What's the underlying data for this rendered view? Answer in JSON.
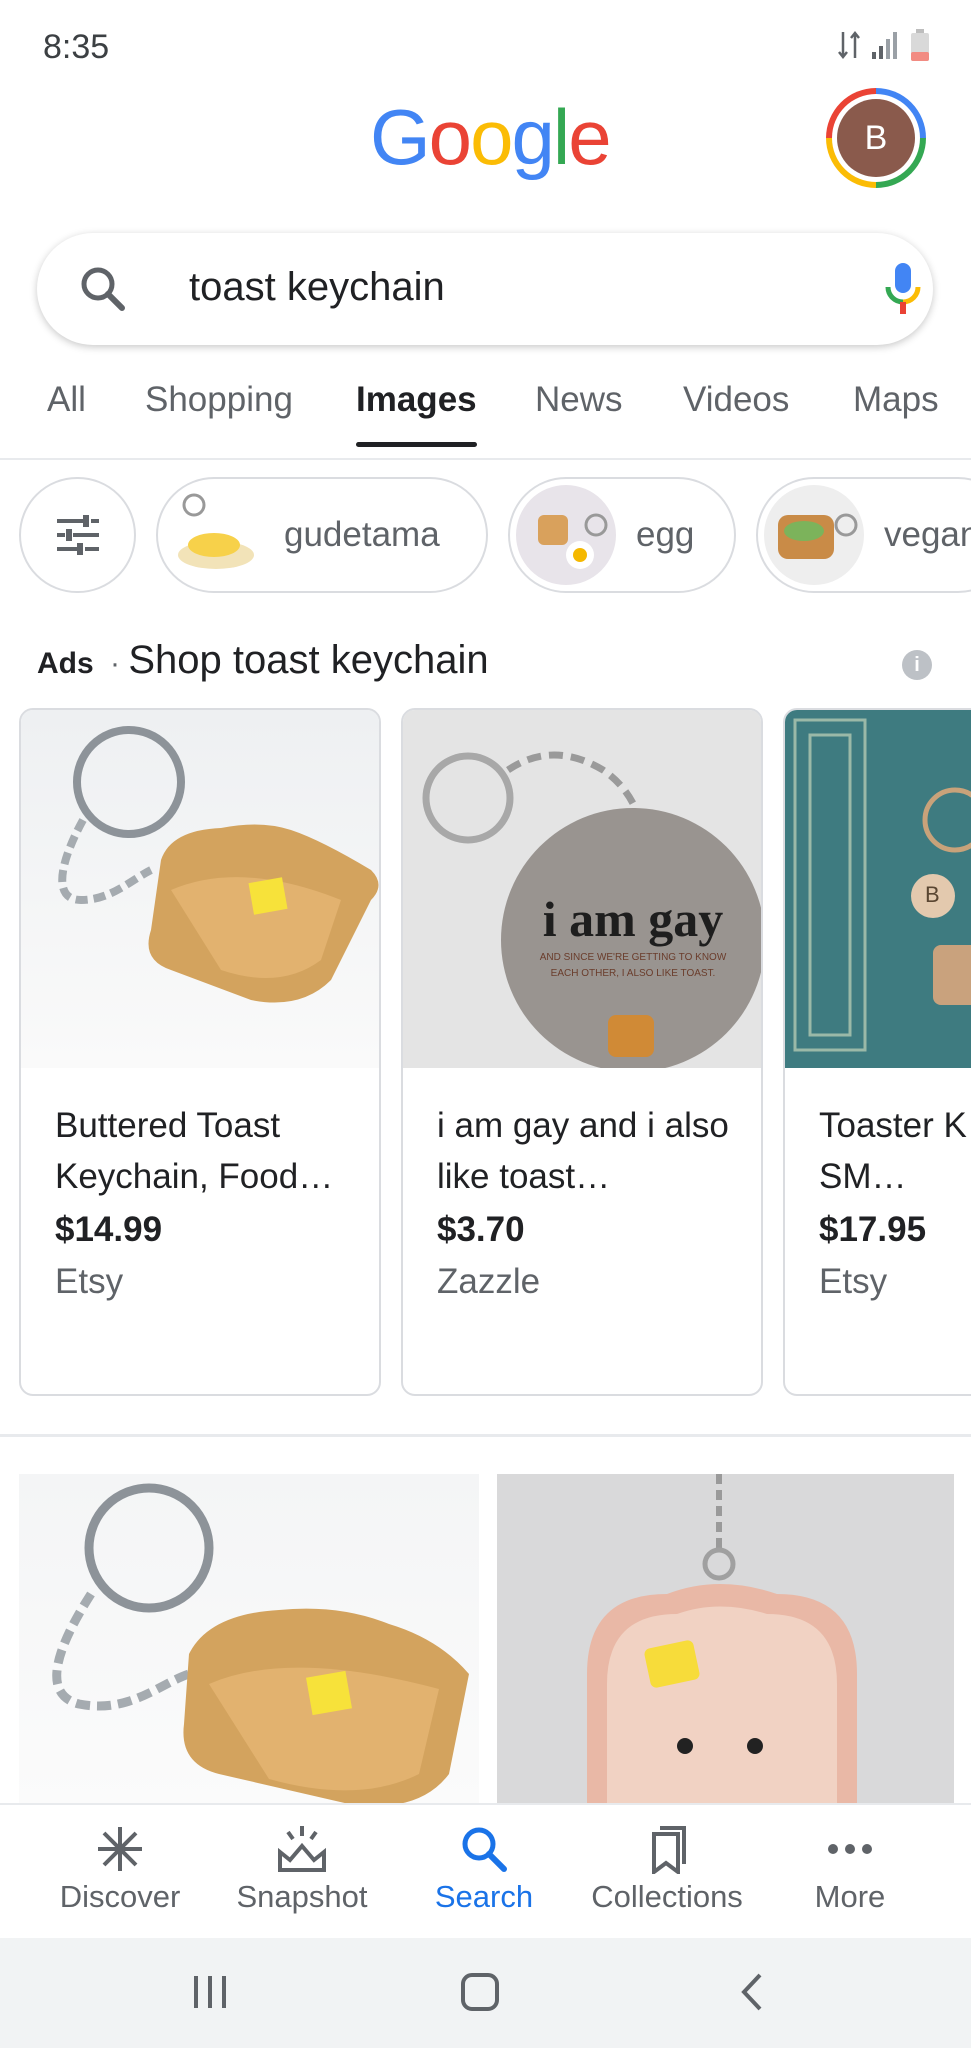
{
  "status_bar": {
    "time": "8:35"
  },
  "header": {
    "logo": "Google",
    "avatar_letter": "B"
  },
  "search": {
    "query": "toast keychain"
  },
  "tabs": [
    {
      "label": "All"
    },
    {
      "label": "Shopping"
    },
    {
      "label": "Images"
    },
    {
      "label": "News"
    },
    {
      "label": "Videos"
    },
    {
      "label": "Maps"
    }
  ],
  "chips": [
    {
      "label": "gudetama"
    },
    {
      "label": "egg"
    },
    {
      "label": "vegan"
    }
  ],
  "ads": {
    "prefix": "Ads",
    "title": "Shop toast keychain",
    "products": [
      {
        "title": "Buttered Toast Keychain, Food…",
        "price": "$14.99",
        "store": "Etsy",
        "image_text": "",
        "image_small": ""
      },
      {
        "title": "i am gay and i also like toast…",
        "price": "$3.70",
        "store": "Zazzle",
        "image_text": "i am gay",
        "image_small": "AND SINCE WE'RE GETTING TO KNOW EACH OTHER, I ALSO LIKE TOAST."
      },
      {
        "title": "Toaster K… VERY SM…",
        "price": "$17.95",
        "store": "Etsy",
        "image_text": "B",
        "image_small": ""
      }
    ]
  },
  "bottom_nav": [
    {
      "label": "Discover",
      "icon": "asterisk-icon"
    },
    {
      "label": "Snapshot",
      "icon": "snapshot-icon"
    },
    {
      "label": "Search",
      "icon": "search-icon"
    },
    {
      "label": "Collections",
      "icon": "bookmark-icon"
    },
    {
      "label": "More",
      "icon": "more-icon"
    }
  ],
  "colors": {
    "accent": "#1a73e8",
    "text": "#202124",
    "muted": "#5f6368"
  }
}
